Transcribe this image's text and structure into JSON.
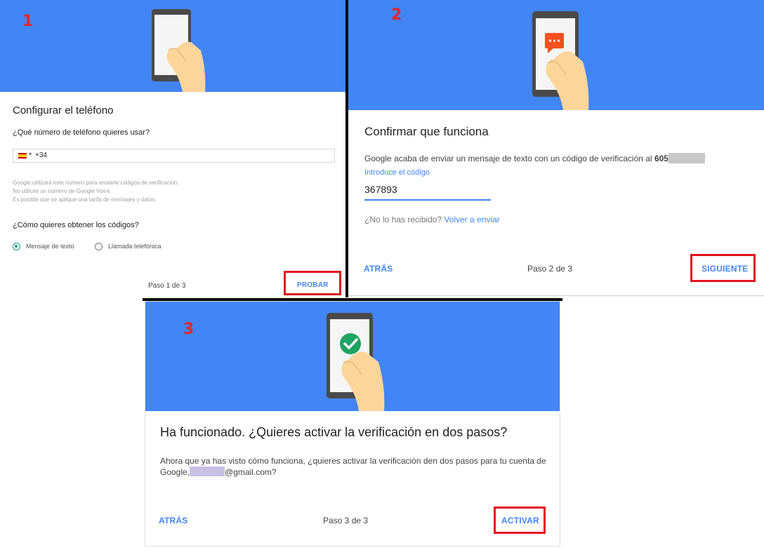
{
  "panels": {
    "p1": {
      "step_marker": "1",
      "title": "Configurar el teléfono",
      "question_phone": "¿Qué número de teléfono quieres usar?",
      "country_flag": "spain-flag-icon",
      "phone_value": "+34",
      "help_lines": [
        "Google utilizará este número para enviarte códigos de verificación.",
        "No utilices un número de Google Voice.",
        "Es posible que se aplique una tarifa de mensajes y datos."
      ],
      "question_method": "¿Cómo quieres obtener los códigos?",
      "option_sms": "Mensaje de texto",
      "option_call": "Llamada telefónica",
      "selected_option": "Mensaje de texto",
      "step_label": "Paso 1 de 3",
      "next_button": "PROBAR"
    },
    "p2": {
      "step_marker": "2",
      "title": "Confirmar que funciona",
      "message": "Google acaba de enviar un mensaje de texto con un código de verificación al",
      "phone_prefix": "605",
      "code_label": "Introduce el código",
      "code_value": "367893",
      "resend_question": "¿No lo has recibido?",
      "resend_link": "Volver a enviar",
      "back_button": "ATRÁS",
      "step_label": "Paso 2 de 3",
      "next_button": "SIGUIENTE"
    },
    "p3": {
      "step_marker": "3",
      "title": "Ha funcionado. ¿Quieres activar la verificación en dos pasos?",
      "body_line1": "Ahora que ya has visto cómo funciona, ¿quieres activar la verificación den dos pasos para tu cuenta de",
      "body_prefix": "Google,",
      "email_suffix": "@gmail.com?",
      "back_button": "ATRÁS",
      "step_label": "Paso 3 de 3",
      "activate_button": "ACTIVAR"
    }
  },
  "colors": {
    "banner": "#4285f4",
    "accent": "#4285f4",
    "highlight": "#e0151d",
    "step_marker": "#e32626",
    "check": "#1fa463",
    "chat_bubble": "#f4511e"
  }
}
